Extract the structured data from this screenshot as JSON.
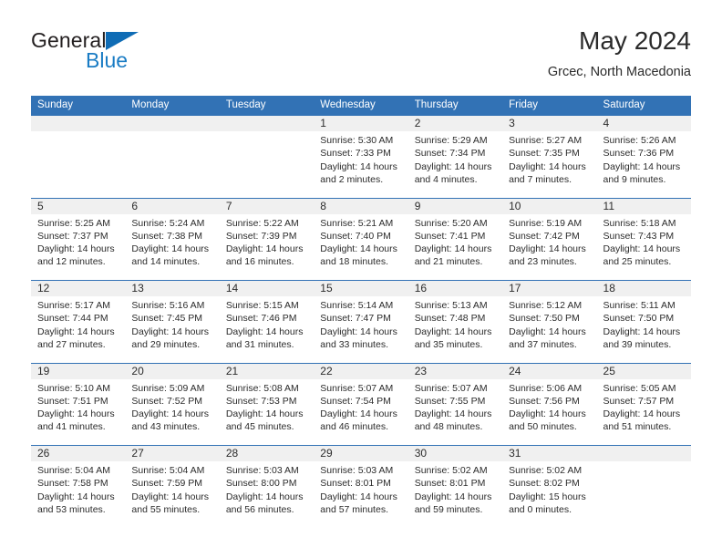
{
  "brand": {
    "name_top": "General",
    "name_bottom": "Blue",
    "accent_color": "#1a7cc4",
    "triangle_icon": "triangle-icon"
  },
  "header": {
    "title": "May 2024",
    "subtitle": "Grcec, North Macedonia"
  },
  "theme": {
    "header_blue": "#3272b5",
    "day_band_gray": "#f0f0f0",
    "text_color": "#2b2b2b"
  },
  "weekdays": [
    "Sunday",
    "Monday",
    "Tuesday",
    "Wednesday",
    "Thursday",
    "Friday",
    "Saturday"
  ],
  "weeks": [
    [
      {
        "day": "",
        "sunrise": "",
        "sunset": "",
        "daylight1": "",
        "daylight2": "",
        "empty": true
      },
      {
        "day": "",
        "sunrise": "",
        "sunset": "",
        "daylight1": "",
        "daylight2": "",
        "empty": true
      },
      {
        "day": "",
        "sunrise": "",
        "sunset": "",
        "daylight1": "",
        "daylight2": "",
        "empty": true
      },
      {
        "day": "1",
        "sunrise": "Sunrise: 5:30 AM",
        "sunset": "Sunset: 7:33 PM",
        "daylight1": "Daylight: 14 hours",
        "daylight2": "and 2 minutes.",
        "empty": false
      },
      {
        "day": "2",
        "sunrise": "Sunrise: 5:29 AM",
        "sunset": "Sunset: 7:34 PM",
        "daylight1": "Daylight: 14 hours",
        "daylight2": "and 4 minutes.",
        "empty": false
      },
      {
        "day": "3",
        "sunrise": "Sunrise: 5:27 AM",
        "sunset": "Sunset: 7:35 PM",
        "daylight1": "Daylight: 14 hours",
        "daylight2": "and 7 minutes.",
        "empty": false
      },
      {
        "day": "4",
        "sunrise": "Sunrise: 5:26 AM",
        "sunset": "Sunset: 7:36 PM",
        "daylight1": "Daylight: 14 hours",
        "daylight2": "and 9 minutes.",
        "empty": false
      }
    ],
    [
      {
        "day": "5",
        "sunrise": "Sunrise: 5:25 AM",
        "sunset": "Sunset: 7:37 PM",
        "daylight1": "Daylight: 14 hours",
        "daylight2": "and 12 minutes.",
        "empty": false
      },
      {
        "day": "6",
        "sunrise": "Sunrise: 5:24 AM",
        "sunset": "Sunset: 7:38 PM",
        "daylight1": "Daylight: 14 hours",
        "daylight2": "and 14 minutes.",
        "empty": false
      },
      {
        "day": "7",
        "sunrise": "Sunrise: 5:22 AM",
        "sunset": "Sunset: 7:39 PM",
        "daylight1": "Daylight: 14 hours",
        "daylight2": "and 16 minutes.",
        "empty": false
      },
      {
        "day": "8",
        "sunrise": "Sunrise: 5:21 AM",
        "sunset": "Sunset: 7:40 PM",
        "daylight1": "Daylight: 14 hours",
        "daylight2": "and 18 minutes.",
        "empty": false
      },
      {
        "day": "9",
        "sunrise": "Sunrise: 5:20 AM",
        "sunset": "Sunset: 7:41 PM",
        "daylight1": "Daylight: 14 hours",
        "daylight2": "and 21 minutes.",
        "empty": false
      },
      {
        "day": "10",
        "sunrise": "Sunrise: 5:19 AM",
        "sunset": "Sunset: 7:42 PM",
        "daylight1": "Daylight: 14 hours",
        "daylight2": "and 23 minutes.",
        "empty": false
      },
      {
        "day": "11",
        "sunrise": "Sunrise: 5:18 AM",
        "sunset": "Sunset: 7:43 PM",
        "daylight1": "Daylight: 14 hours",
        "daylight2": "and 25 minutes.",
        "empty": false
      }
    ],
    [
      {
        "day": "12",
        "sunrise": "Sunrise: 5:17 AM",
        "sunset": "Sunset: 7:44 PM",
        "daylight1": "Daylight: 14 hours",
        "daylight2": "and 27 minutes.",
        "empty": false
      },
      {
        "day": "13",
        "sunrise": "Sunrise: 5:16 AM",
        "sunset": "Sunset: 7:45 PM",
        "daylight1": "Daylight: 14 hours",
        "daylight2": "and 29 minutes.",
        "empty": false
      },
      {
        "day": "14",
        "sunrise": "Sunrise: 5:15 AM",
        "sunset": "Sunset: 7:46 PM",
        "daylight1": "Daylight: 14 hours",
        "daylight2": "and 31 minutes.",
        "empty": false
      },
      {
        "day": "15",
        "sunrise": "Sunrise: 5:14 AM",
        "sunset": "Sunset: 7:47 PM",
        "daylight1": "Daylight: 14 hours",
        "daylight2": "and 33 minutes.",
        "empty": false
      },
      {
        "day": "16",
        "sunrise": "Sunrise: 5:13 AM",
        "sunset": "Sunset: 7:48 PM",
        "daylight1": "Daylight: 14 hours",
        "daylight2": "and 35 minutes.",
        "empty": false
      },
      {
        "day": "17",
        "sunrise": "Sunrise: 5:12 AM",
        "sunset": "Sunset: 7:50 PM",
        "daylight1": "Daylight: 14 hours",
        "daylight2": "and 37 minutes.",
        "empty": false
      },
      {
        "day": "18",
        "sunrise": "Sunrise: 5:11 AM",
        "sunset": "Sunset: 7:50 PM",
        "daylight1": "Daylight: 14 hours",
        "daylight2": "and 39 minutes.",
        "empty": false
      }
    ],
    [
      {
        "day": "19",
        "sunrise": "Sunrise: 5:10 AM",
        "sunset": "Sunset: 7:51 PM",
        "daylight1": "Daylight: 14 hours",
        "daylight2": "and 41 minutes.",
        "empty": false
      },
      {
        "day": "20",
        "sunrise": "Sunrise: 5:09 AM",
        "sunset": "Sunset: 7:52 PM",
        "daylight1": "Daylight: 14 hours",
        "daylight2": "and 43 minutes.",
        "empty": false
      },
      {
        "day": "21",
        "sunrise": "Sunrise: 5:08 AM",
        "sunset": "Sunset: 7:53 PM",
        "daylight1": "Daylight: 14 hours",
        "daylight2": "and 45 minutes.",
        "empty": false
      },
      {
        "day": "22",
        "sunrise": "Sunrise: 5:07 AM",
        "sunset": "Sunset: 7:54 PM",
        "daylight1": "Daylight: 14 hours",
        "daylight2": "and 46 minutes.",
        "empty": false
      },
      {
        "day": "23",
        "sunrise": "Sunrise: 5:07 AM",
        "sunset": "Sunset: 7:55 PM",
        "daylight1": "Daylight: 14 hours",
        "daylight2": "and 48 minutes.",
        "empty": false
      },
      {
        "day": "24",
        "sunrise": "Sunrise: 5:06 AM",
        "sunset": "Sunset: 7:56 PM",
        "daylight1": "Daylight: 14 hours",
        "daylight2": "and 50 minutes.",
        "empty": false
      },
      {
        "day": "25",
        "sunrise": "Sunrise: 5:05 AM",
        "sunset": "Sunset: 7:57 PM",
        "daylight1": "Daylight: 14 hours",
        "daylight2": "and 51 minutes.",
        "empty": false
      }
    ],
    [
      {
        "day": "26",
        "sunrise": "Sunrise: 5:04 AM",
        "sunset": "Sunset: 7:58 PM",
        "daylight1": "Daylight: 14 hours",
        "daylight2": "and 53 minutes.",
        "empty": false
      },
      {
        "day": "27",
        "sunrise": "Sunrise: 5:04 AM",
        "sunset": "Sunset: 7:59 PM",
        "daylight1": "Daylight: 14 hours",
        "daylight2": "and 55 minutes.",
        "empty": false
      },
      {
        "day": "28",
        "sunrise": "Sunrise: 5:03 AM",
        "sunset": "Sunset: 8:00 PM",
        "daylight1": "Daylight: 14 hours",
        "daylight2": "and 56 minutes.",
        "empty": false
      },
      {
        "day": "29",
        "sunrise": "Sunrise: 5:03 AM",
        "sunset": "Sunset: 8:01 PM",
        "daylight1": "Daylight: 14 hours",
        "daylight2": "and 57 minutes.",
        "empty": false
      },
      {
        "day": "30",
        "sunrise": "Sunrise: 5:02 AM",
        "sunset": "Sunset: 8:01 PM",
        "daylight1": "Daylight: 14 hours",
        "daylight2": "and 59 minutes.",
        "empty": false
      },
      {
        "day": "31",
        "sunrise": "Sunrise: 5:02 AM",
        "sunset": "Sunset: 8:02 PM",
        "daylight1": "Daylight: 15 hours",
        "daylight2": "and 0 minutes.",
        "empty": false
      },
      {
        "day": "",
        "sunrise": "",
        "sunset": "",
        "daylight1": "",
        "daylight2": "",
        "empty": true
      }
    ]
  ]
}
